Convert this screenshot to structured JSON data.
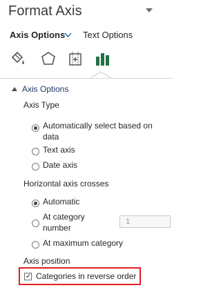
{
  "pane": {
    "title": "Format Axis"
  },
  "options_tabs": {
    "axis_options": "Axis Options",
    "text_options": "Text Options"
  },
  "icon_tabs": [
    "fill-line-icon",
    "effects-icon",
    "size-properties-icon",
    "axis-options-icon"
  ],
  "section": {
    "title": "Axis Options"
  },
  "axis_type": {
    "heading": "Axis Type",
    "auto_line1": "Automatically select based on",
    "auto_line2": "data",
    "text_axis": "Text axis",
    "date_axis": "Date axis",
    "selected": "auto"
  },
  "crosses": {
    "heading": "Horizontal axis crosses",
    "automatic": "Automatic",
    "at_category_line1": "At category",
    "at_category_line2": "number",
    "at_category_value": "1",
    "at_max": "At maximum category",
    "selected": "automatic"
  },
  "axis_position": {
    "heading": "Axis position",
    "reverse_label": "Categories in reverse order",
    "reverse_checked": true
  },
  "colors": {
    "highlight": "#e41e1e",
    "accent": "#217346",
    "section": "#1f3864"
  }
}
